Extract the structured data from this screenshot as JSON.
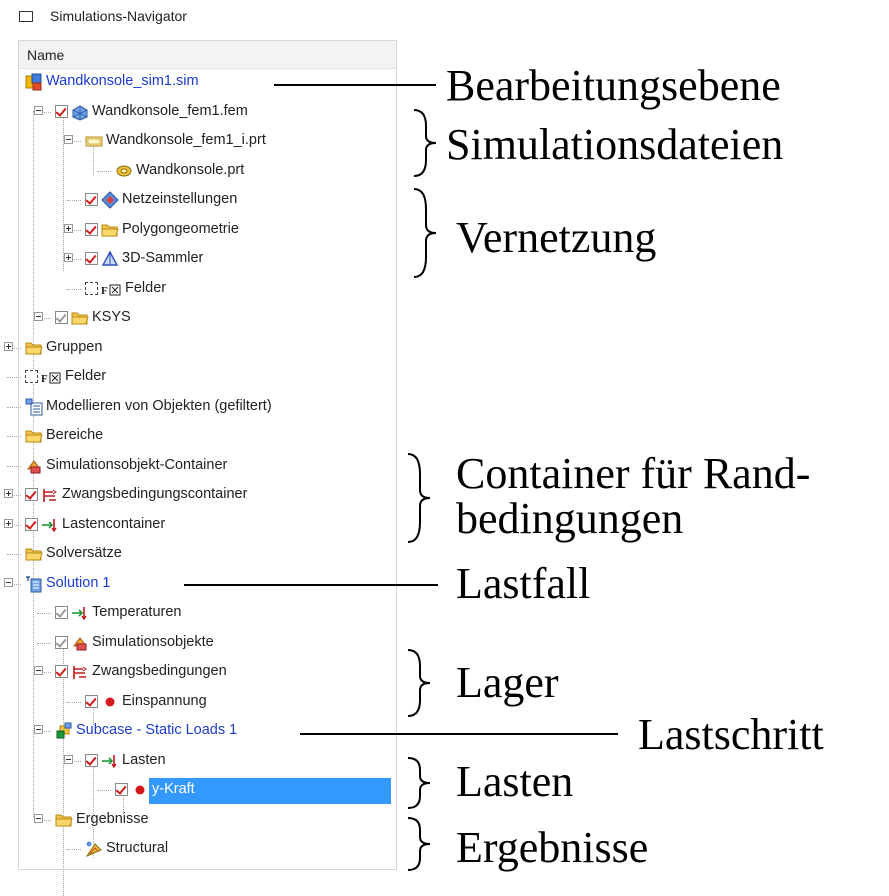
{
  "window": {
    "title": "Simulations-Navigator"
  },
  "column_header": "Name",
  "tree": [
    {
      "label": "Wandkonsole_sim1.sim",
      "blue": true,
      "icon": "sim-file-icon"
    },
    {
      "label": "Wandkonsole_fem1.fem",
      "icon": "fem-file-icon",
      "check": "on",
      "exp": "minus"
    },
    {
      "label": "Wandkonsole_fem1_i.prt",
      "icon": "part-folder-icon",
      "exp": "minus"
    },
    {
      "label": "Wandkonsole.prt",
      "icon": "part-icon"
    },
    {
      "label": "Netzeinstellungen",
      "icon": "mesh-settings-icon",
      "check": "on"
    },
    {
      "label": "Polygongeometrie",
      "icon": "folder-icon",
      "check": "on",
      "exp": "plus"
    },
    {
      "label": "3D-Sammler",
      "icon": "collector-icon",
      "check": "on",
      "exp": "plus"
    },
    {
      "label": "Felder",
      "icon": "field-icon",
      "check": "dash"
    },
    {
      "label": "KSYS",
      "icon": "folder-icon",
      "check": "grey",
      "exp": "minus"
    },
    {
      "label": "Gruppen",
      "icon": "folder-icon",
      "exp": "plus"
    },
    {
      "label": "Felder",
      "icon": "field-icon",
      "check": "dash"
    },
    {
      "label": "Modellieren von Objekten (gefiltert)",
      "icon": "modeling-objects-icon"
    },
    {
      "label": "Bereiche",
      "icon": "folder-icon"
    },
    {
      "label": "Simulationsobjekt-Container",
      "icon": "simulation-object-icon"
    },
    {
      "label": "Zwangsbedingungscontainer",
      "icon": "constraint-icon",
      "check": "on",
      "exp": "plus"
    },
    {
      "label": "Lastencontainer",
      "icon": "load-icon",
      "check": "on",
      "exp": "plus"
    },
    {
      "label": "Solversätze",
      "icon": "folder-icon"
    },
    {
      "label": "Solution 1",
      "blue": true,
      "icon": "solution-icon",
      "exp": "minus"
    },
    {
      "label": "Temperaturen",
      "icon": "load-icon",
      "check": "grey"
    },
    {
      "label": "Simulationsobjekte",
      "icon": "simulation-object-icon",
      "check": "grey"
    },
    {
      "label": "Zwangsbedingungen",
      "icon": "constraint-icon",
      "check": "on",
      "exp": "minus"
    },
    {
      "label": "Einspannung",
      "icon": "red-dot-icon",
      "check": "on"
    },
    {
      "label": "Subcase - Static Loads 1",
      "blue": true,
      "icon": "subcase-icon",
      "exp": "minus"
    },
    {
      "label": "Lasten",
      "icon": "load-icon",
      "check": "on",
      "exp": "minus"
    },
    {
      "label": "y-Kraft",
      "icon": "red-dot-icon",
      "check": "on",
      "selected": true
    },
    {
      "label": "Ergebnisse",
      "icon": "folder-icon",
      "exp": "minus"
    },
    {
      "label": "Structural",
      "icon": "results-icon"
    }
  ],
  "annotations": {
    "bearbeitungsebene": "Bearbeitungsebene",
    "simulationsdateien": "Simulationsdateien",
    "vernetzung": "Vernetzung",
    "container_line1": "Container für Rand-",
    "container_line2": "bedingungen",
    "lastfall": "Lastfall",
    "lager": "Lager",
    "lastschritt": "Lastschritt",
    "lasten": "Lasten",
    "ergebnisse": "Ergebnisse"
  },
  "colors": {
    "selection": "#3399ff",
    "link_blue": "#1c3ccf",
    "check_red": "#d11a1a"
  }
}
